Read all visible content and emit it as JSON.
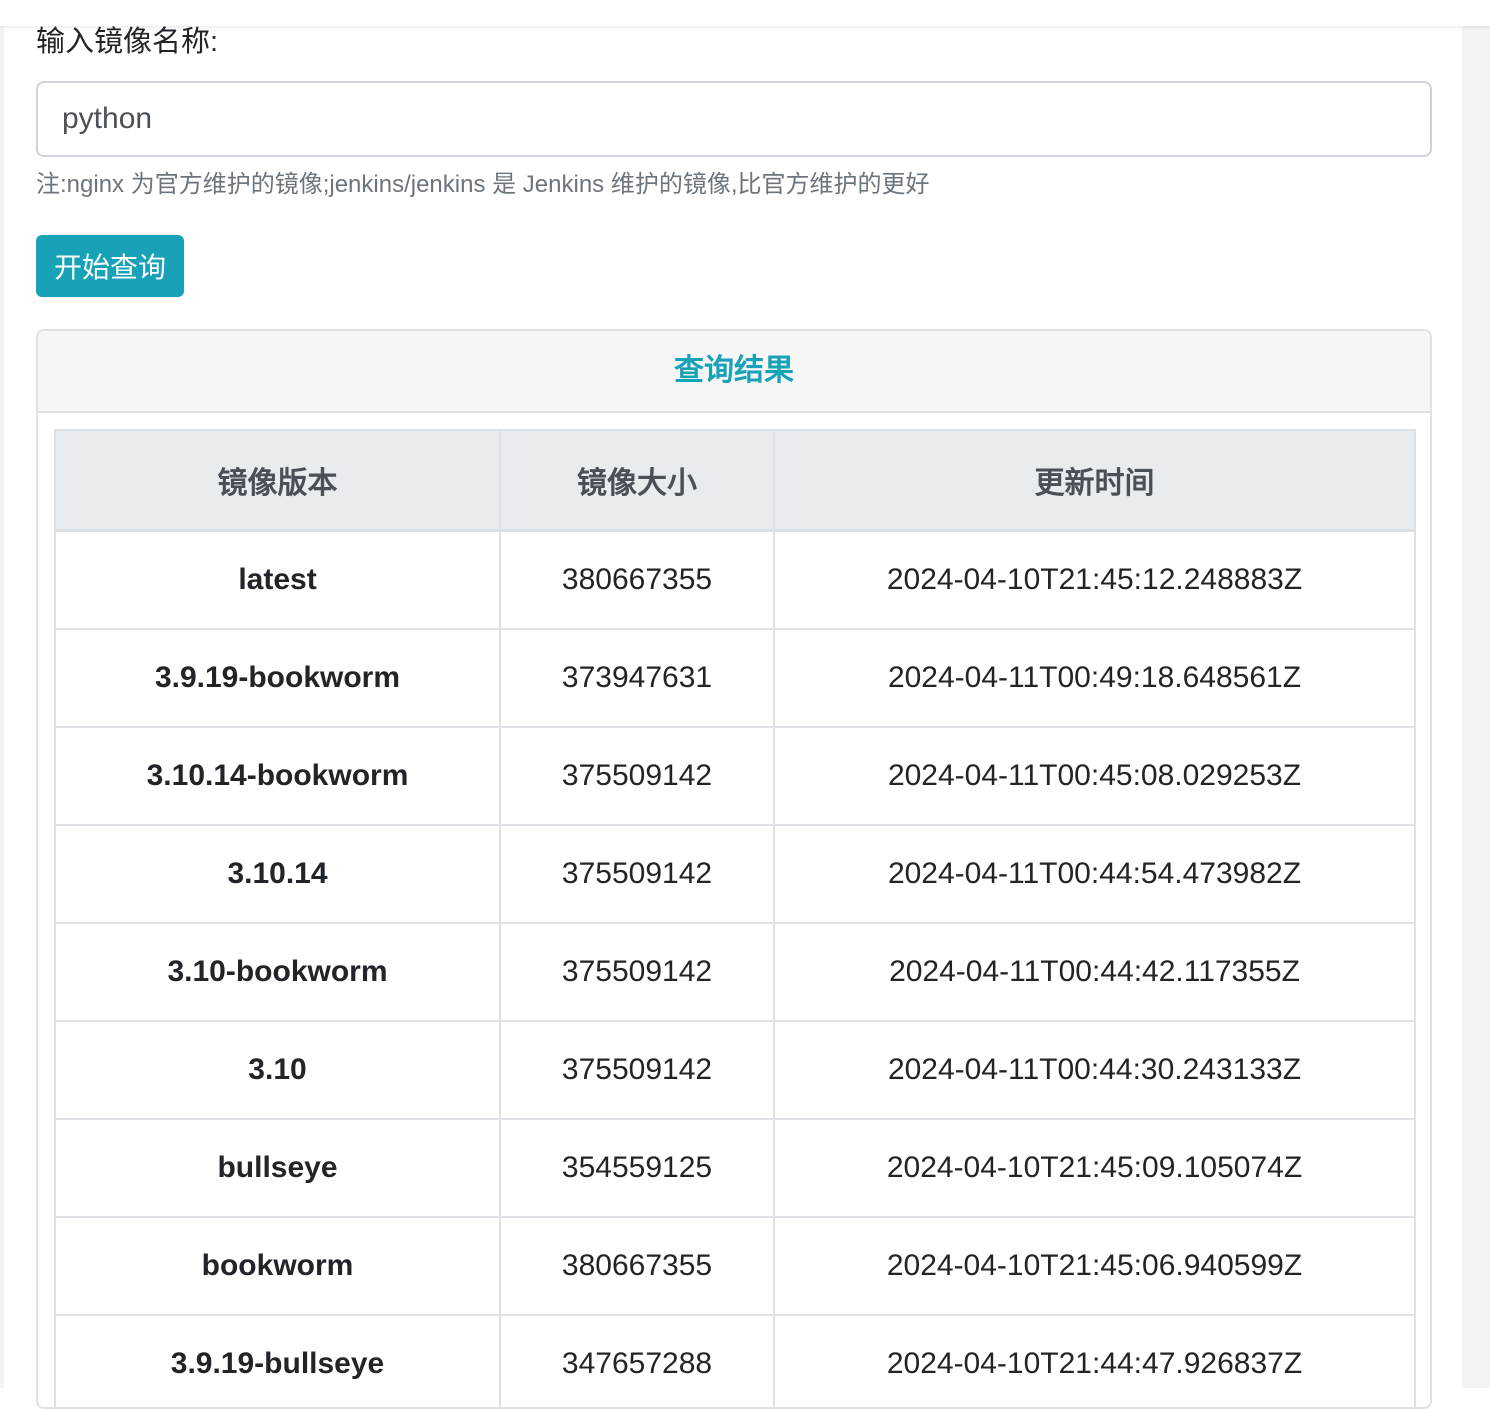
{
  "form": {
    "label": "输入镜像名称:",
    "input_value": "python",
    "hint": "注:nginx 为官方维护的镜像;jenkins/jenkins 是 Jenkins 维护的镜像,比官方维护的更好",
    "button_label": "开始查询"
  },
  "results": {
    "title": "查询结果",
    "columns": [
      "镜像版本",
      "镜像大小",
      "更新时间"
    ],
    "rows": [
      {
        "tag": "latest",
        "size": "380667355",
        "updated": "2024-04-10T21:45:12.248883Z"
      },
      {
        "tag": "3.9.19-bookworm",
        "size": "373947631",
        "updated": "2024-04-11T00:49:18.648561Z"
      },
      {
        "tag": "3.10.14-bookworm",
        "size": "375509142",
        "updated": "2024-04-11T00:45:08.029253Z"
      },
      {
        "tag": "3.10.14",
        "size": "375509142",
        "updated": "2024-04-11T00:44:54.473982Z"
      },
      {
        "tag": "3.10-bookworm",
        "size": "375509142",
        "updated": "2024-04-11T00:44:42.117355Z"
      },
      {
        "tag": "3.10",
        "size": "375509142",
        "updated": "2024-04-11T00:44:30.243133Z"
      },
      {
        "tag": "bullseye",
        "size": "354559125",
        "updated": "2024-04-10T21:45:09.105074Z"
      },
      {
        "tag": "bookworm",
        "size": "380667355",
        "updated": "2024-04-10T21:45:06.940599Z"
      },
      {
        "tag": "3.9.19-bullseye",
        "size": "347657288",
        "updated": "2024-04-10T21:44:47.926837Z"
      }
    ]
  },
  "colors": {
    "accent": "#17a2b8",
    "header_bg": "#e9ecef",
    "border": "#dee2e6"
  }
}
